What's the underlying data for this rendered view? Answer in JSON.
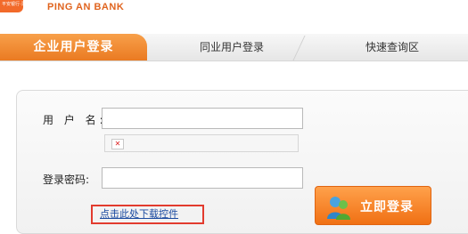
{
  "header": {
    "logo_small_text": "平安银行·深发",
    "bank_name": "PING AN BANK"
  },
  "tabs": [
    {
      "label": "企业用户登录",
      "active": true
    },
    {
      "label": "同业用户登录",
      "active": false
    },
    {
      "label": "快速查询区",
      "active": false
    }
  ],
  "form": {
    "username_label": "用 户 名:",
    "username_value": "",
    "password_label": "登录密码:",
    "password_value": "",
    "plugin_icon": "broken-image-icon",
    "download_link": "点击此处下载控件",
    "login_button": "立即登录"
  },
  "colors": {
    "accent": "#f07a1e",
    "link": "#1b4aa0",
    "highlight_border": "#e23b2e"
  }
}
